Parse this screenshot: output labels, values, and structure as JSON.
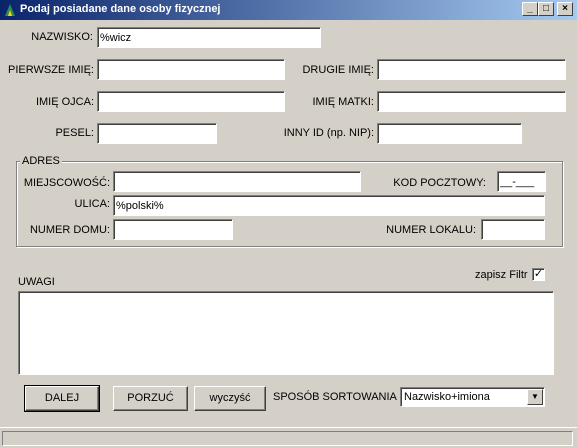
{
  "window": {
    "title": "Podaj posiadane dane osoby fizycznej",
    "min_glyph": "_",
    "max_glyph": "□",
    "close_glyph": "×"
  },
  "fields": {
    "nazwisko": {
      "label": "NAZWISKO:",
      "value": "%wicz"
    },
    "pierwsze_imie": {
      "label": "PIERWSZE IMIĘ:",
      "value": ""
    },
    "drugie_imie": {
      "label": "DRUGIE IMIĘ:",
      "value": ""
    },
    "imie_ojca": {
      "label": "IMIĘ OJCA:",
      "value": ""
    },
    "imie_matki": {
      "label": "IMIĘ MATKI:",
      "value": ""
    },
    "pesel": {
      "label": "PESEL:",
      "value": ""
    },
    "inny_id": {
      "label": "INNY ID (np. NIP):",
      "value": ""
    }
  },
  "adres": {
    "title": "ADRES",
    "miejscowosc": {
      "label": "MIEJSCOWOŚĆ:",
      "value": ""
    },
    "kod_pocztowy": {
      "label": "KOD POCZTOWY:",
      "value": "__-___"
    },
    "ulica": {
      "label": "ULICA:",
      "value": "%polski%"
    },
    "numer_domu": {
      "label": "NUMER DOMU:",
      "value": ""
    },
    "numer_lokalu": {
      "label": "NUMER LOKALU:",
      "value": ""
    }
  },
  "uwagi": {
    "label": "UWAGI",
    "value": ""
  },
  "filter": {
    "label": "zapisz Filtr",
    "checked": true,
    "check_glyph": "✓"
  },
  "buttons": {
    "dalej": "DALEJ",
    "porzuc": "PORZUĆ",
    "wyczysc": "wyczyść"
  },
  "sort": {
    "label": "SPOSÓB SORTOWANIA",
    "selected": "Nazwisko+imiona",
    "arrow_glyph": "▼"
  },
  "colors": {
    "face": "#d4d0c8",
    "title_start": "#0a246a",
    "title_end": "#a6caf0"
  }
}
